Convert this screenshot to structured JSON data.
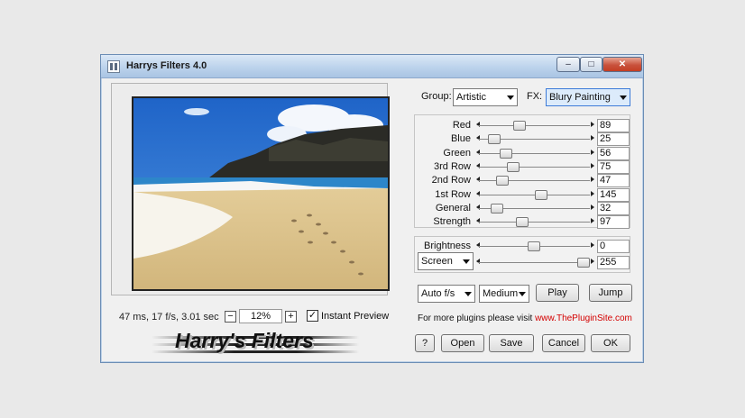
{
  "window": {
    "title": "Harrys Filters 4.0",
    "min_glyph": "–",
    "max_glyph": "□",
    "close_glyph": "✕"
  },
  "preview": {
    "status": "47 ms, 17 f/s, 3.01 sec",
    "zoom": {
      "minus": "−",
      "value": "12%",
      "plus": "+"
    },
    "instant_preview": {
      "label": "Instant Preview",
      "checked": true,
      "check_glyph": "✓"
    }
  },
  "logo": {
    "text": "Harry's Filters"
  },
  "group": {
    "label": "Group:",
    "value": "Artistic"
  },
  "fx": {
    "label": "FX:",
    "value": "Blury Painting"
  },
  "sliders": [
    {
      "label": "Red",
      "value": "89",
      "fraction": 0.35
    },
    {
      "label": "Blue",
      "value": "25",
      "fraction": 0.1
    },
    {
      "label": "Green",
      "value": "56",
      "fraction": 0.22
    },
    {
      "label": "3rd Row",
      "value": "75",
      "fraction": 0.29
    },
    {
      "label": "2nd Row",
      "value": "47",
      "fraction": 0.18
    },
    {
      "label": "1st Row",
      "value": "145",
      "fraction": 0.57
    },
    {
      "label": "General",
      "value": "32",
      "fraction": 0.13
    },
    {
      "label": "Strength",
      "value": "97",
      "fraction": 0.38
    }
  ],
  "brightness": {
    "label": "Brightness",
    "value": "0",
    "fraction": 0.5
  },
  "blend": {
    "mode": "Screen",
    "value": "255",
    "fraction": 1.0
  },
  "playback": {
    "speed": "Auto f/s",
    "quality": "Medium",
    "play": "Play",
    "jump": "Jump"
  },
  "plugins": {
    "text": "For more plugins please visit ",
    "link": "www.ThePluginSite.com"
  },
  "buttons": {
    "help": "?",
    "open": "Open",
    "save": "Save",
    "cancel": "Cancel",
    "ok": "OK"
  },
  "colors": {
    "accent": "#3d7bd8",
    "link": "#d40000"
  }
}
